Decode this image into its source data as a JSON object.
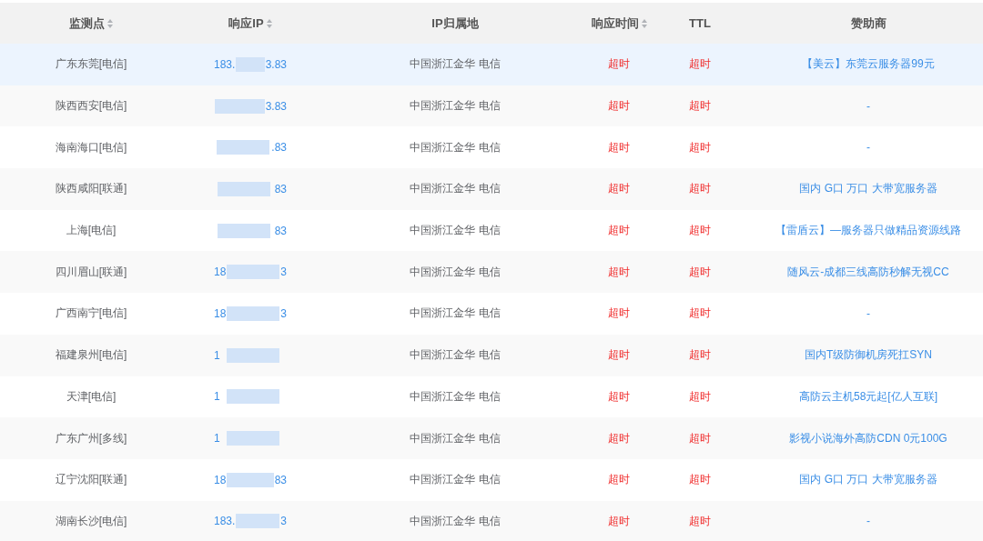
{
  "table": {
    "columns": [
      {
        "label": "监测点",
        "sortable": true
      },
      {
        "label": "响应IP",
        "sortable": true
      },
      {
        "label": "IP归属地",
        "sortable": false
      },
      {
        "label": "响应时间",
        "sortable": true
      },
      {
        "label": "TTL",
        "sortable": false
      },
      {
        "label": "赞助商",
        "sortable": false
      }
    ],
    "rows": [
      {
        "node": "广东东莞[电信]",
        "ip_head": "183.",
        "ip_tail": "3.83",
        "location": "中国浙江金华 电信",
        "response_time": "超时",
        "ttl": "超时",
        "sponsor": "【美云】东莞云服务器99元",
        "highlighted": true
      },
      {
        "node": "陕西西安[电信]",
        "ip_tail": "3.83",
        "location": "中国浙江金华 电信",
        "response_time": "超时",
        "ttl": "超时",
        "sponsor": "-",
        "highlighted": false
      },
      {
        "node": "海南海口[电信]",
        "ip_tail": ".83",
        "location": "中国浙江金华 电信",
        "response_time": "超时",
        "ttl": "超时",
        "sponsor": "-",
        "highlighted": false
      },
      {
        "node": "陕西咸阳[联通]",
        "ip_tail": "83",
        "location": "中国浙江金华 电信",
        "response_time": "超时",
        "ttl": "超时",
        "sponsor": "国内 G口 万口 大带宽服务器",
        "highlighted": false
      },
      {
        "node": "上海[电信]",
        "ip_tail": "83",
        "location": "中国浙江金华 电信",
        "response_time": "超时",
        "ttl": "超时",
        "sponsor": "【雷盾云】—服务器只做精品资源线路",
        "highlighted": false
      },
      {
        "node": "四川眉山[联通]",
        "ip_head": "18",
        "ip_tail": "3",
        "location": "中国浙江金华 电信",
        "response_time": "超时",
        "ttl": "超时",
        "sponsor": "随风云-成都三线高防秒解无视CC",
        "highlighted": false
      },
      {
        "node": "广西南宁[电信]",
        "ip_head": "18",
        "ip_tail": "3",
        "location": "中国浙江金华 电信",
        "response_time": "超时",
        "ttl": "超时",
        "sponsor": "-",
        "highlighted": false
      },
      {
        "node": "福建泉州[电信]",
        "ip_head": "1",
        "location": "中国浙江金华 电信",
        "response_time": "超时",
        "ttl": "超时",
        "sponsor": "国内T级防御机房死扛SYN",
        "highlighted": false
      },
      {
        "node": "天津[电信]",
        "ip_head": "1",
        "location": "中国浙江金华 电信",
        "response_time": "超时",
        "ttl": "超时",
        "sponsor": "高防云主机58元起[亿人互联]",
        "highlighted": false
      },
      {
        "node": "广东广州[多线]",
        "ip_head": "1",
        "location": "中国浙江金华 电信",
        "response_time": "超时",
        "ttl": "超时",
        "sponsor": "影视小说海外高防CDN 0元100G",
        "highlighted": false
      },
      {
        "node": "辽宁沈阳[联通]",
        "ip_head": "18",
        "ip_tail": "83",
        "location": "中国浙江金华 电信",
        "response_time": "超时",
        "ttl": "超时",
        "sponsor": "国内 G口 万口 大带宽服务器",
        "highlighted": false
      },
      {
        "node": "湖南长沙[电信]",
        "ip_head": "183.",
        "ip_tail": "3",
        "location": "中国浙江金华 电信",
        "response_time": "超时",
        "ttl": "超时",
        "sponsor": "-",
        "highlighted": false
      }
    ]
  }
}
